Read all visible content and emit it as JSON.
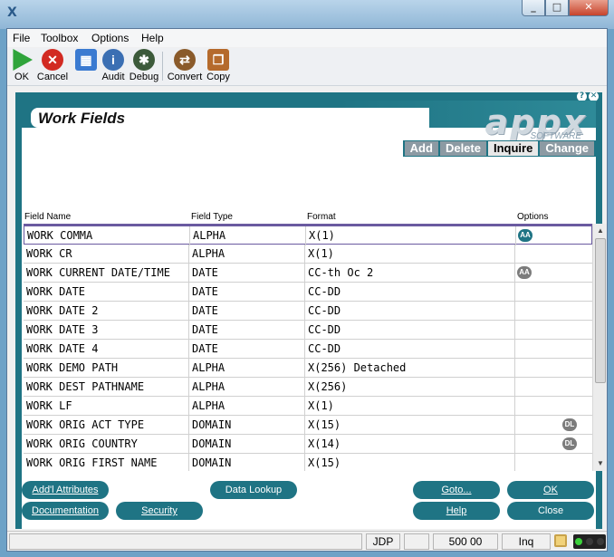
{
  "window": {
    "icon": "appx-icon",
    "min": "_",
    "max": "□",
    "close": "✕"
  },
  "menu": [
    "File",
    "Toolbox",
    "Options",
    "Help"
  ],
  "toolbar": [
    {
      "label": "OK",
      "icon": "ok-icon",
      "color": "#2fa43b"
    },
    {
      "label": "Cancel",
      "icon": "cancel-icon",
      "color": "#d22a22"
    },
    {
      "label": "",
      "icon": "windows-icon",
      "color": "#3a7ad1"
    },
    {
      "label": "Audit",
      "icon": "audit-icon",
      "color": "#3b6fb3"
    },
    {
      "label": "Debug",
      "icon": "debug-icon",
      "color": "#3c5a3a"
    },
    {
      "label": "Convert",
      "icon": "convert-icon",
      "color": "#8a5a2a"
    },
    {
      "label": "Copy",
      "icon": "copy-icon",
      "color": "#b56a2c"
    }
  ],
  "app": {
    "title": "Work Fields",
    "logo": "appx",
    "logo_sub": "SOFTWARE",
    "modes": [
      {
        "label": "Add",
        "active": false
      },
      {
        "label": "Delete",
        "active": false
      },
      {
        "label": "Inquire",
        "active": true
      },
      {
        "label": "Change",
        "active": false
      }
    ]
  },
  "grid": {
    "columns": [
      "Field Name",
      "Field Type",
      "Format",
      "Options"
    ],
    "rows": [
      {
        "name": "WORK COMMA",
        "type": "ALPHA",
        "format": "X(1)",
        "option": "AA"
      },
      {
        "name": "WORK CR",
        "type": "ALPHA",
        "format": "X(1)",
        "option": ""
      },
      {
        "name": "WORK CURRENT DATE/TIME",
        "type": "DATE",
        "format": "CC-th Oc 2",
        "option": "AA"
      },
      {
        "name": "WORK DATE",
        "type": "DATE",
        "format": "CC-DD",
        "option": ""
      },
      {
        "name": "WORK DATE 2",
        "type": "DATE",
        "format": "CC-DD",
        "option": ""
      },
      {
        "name": "WORK DATE 3",
        "type": "DATE",
        "format": "CC-DD",
        "option": ""
      },
      {
        "name": "WORK DATE 4",
        "type": "DATE",
        "format": "CC-DD",
        "option": ""
      },
      {
        "name": "WORK DEMO PATH",
        "type": "ALPHA",
        "format": "X(256) Detached",
        "option": ""
      },
      {
        "name": "WORK DEST PATHNAME",
        "type": "ALPHA",
        "format": "X(256)",
        "option": ""
      },
      {
        "name": "WORK LF",
        "type": "ALPHA",
        "format": "X(1)",
        "option": ""
      },
      {
        "name": "WORK ORIG ACT TYPE",
        "type": "DOMAIN",
        "format": "X(15)",
        "option": "DL"
      },
      {
        "name": "WORK ORIG COUNTRY",
        "type": "DOMAIN",
        "format": "X(14)",
        "option": "DL"
      },
      {
        "name": "WORK ORIG FIRST NAME",
        "type": "DOMAIN",
        "format": "X(15)",
        "option": ""
      }
    ]
  },
  "buttons": {
    "addl": "Add'l Attributes",
    "data_lookup": "Data Lookup",
    "goto": "Goto...",
    "ok": "OK",
    "documentation": "Documentation",
    "security": "Security",
    "help": "Help",
    "close": "Close"
  },
  "status": {
    "user": "JDP",
    "count": "500 00",
    "mode": "Inq"
  }
}
